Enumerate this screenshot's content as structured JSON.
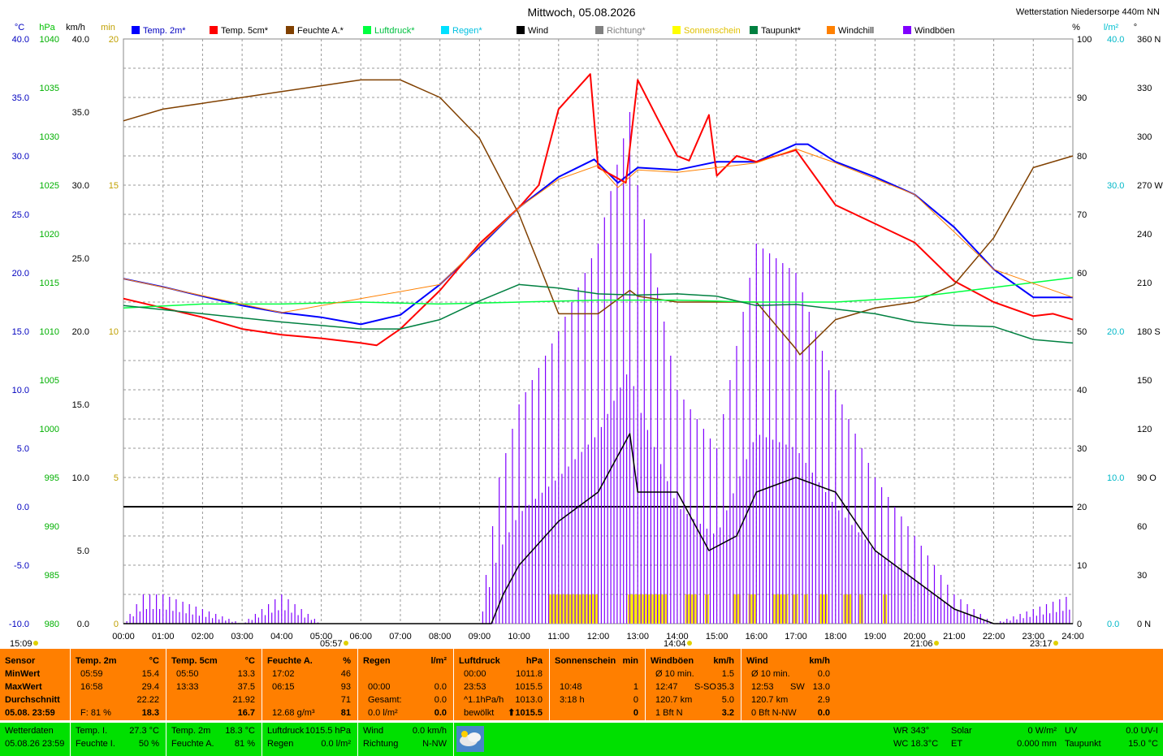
{
  "title": "Mittwoch, 05.08.2026",
  "station": "Wetterstation Niedersorpe 440m NN",
  "axes": {
    "temp_unit": "°C",
    "press_unit": "hPa",
    "wind_unit": "km/h",
    "sun_unit": "min",
    "hum_unit": "%",
    "rain_unit": "l/m²",
    "dir_unit": "°",
    "temp_ticks": [
      "40.0",
      "35.0",
      "30.0",
      "25.0",
      "20.0",
      "15.0",
      "10.0",
      "5.0",
      "0.0",
      "-5.0",
      "-10.0"
    ],
    "press_ticks": [
      "1040",
      "1035",
      "1030",
      "1025",
      "1020",
      "1015",
      "1010",
      "1005",
      "1000",
      "995",
      "990",
      "985",
      "980"
    ],
    "wind_ticks": [
      "40.0",
      "35.0",
      "30.0",
      "25.0",
      "20.0",
      "15.0",
      "10.0",
      "5.0",
      "0.0"
    ],
    "sun_ticks": [
      "20",
      "15",
      "10",
      "5",
      "0"
    ],
    "hum_ticks": [
      "100",
      "90",
      "80",
      "70",
      "60",
      "50",
      "40",
      "30",
      "20",
      "10",
      "0"
    ],
    "rain_ticks": [
      "40.0",
      "30.0",
      "20.0",
      "10.0",
      "0.0"
    ],
    "dir_ticks": [
      "360 N",
      "330",
      "300",
      "270 W",
      "240",
      "210",
      "180 S",
      "150",
      "120",
      "90 O",
      "60",
      "30",
      "0 N"
    ],
    "time_ticks": [
      "00:00",
      "01:00",
      "02:00",
      "03:00",
      "04:00",
      "05:00",
      "06:00",
      "07:00",
      "08:00",
      "09:00",
      "10:00",
      "11:00",
      "12:00",
      "13:00",
      "14:00",
      "15:00",
      "16:00",
      "17:00",
      "18:00",
      "19:00",
      "20:00",
      "21:00",
      "22:00",
      "23:00",
      "24:00"
    ],
    "markers": [
      "15:09",
      "05:57",
      "14:04",
      "21:06",
      "23:17"
    ]
  },
  "legend": [
    {
      "label": "Temp. 2m*",
      "color": "#0000ff"
    },
    {
      "label": "Temp. 5cm*",
      "color": "#ff0000"
    },
    {
      "label": "Feuchte A.*",
      "color": "#804000"
    },
    {
      "label": "Luftdruck*",
      "color": "#00ff40"
    },
    {
      "label": "Regen*",
      "color": "#00e0ff"
    },
    {
      "label": "Wind",
      "color": "#000000"
    },
    {
      "label": "Richtung*",
      "color": "#808080"
    },
    {
      "label": "Sonnenschein",
      "color": "#ffff00"
    },
    {
      "label": "Taupunkt*",
      "color": "#008040"
    },
    {
      "label": "Windchill",
      "color": "#ff8000"
    },
    {
      "label": "Windböen",
      "color": "#8000ff"
    }
  ],
  "chart_data": {
    "type": "line",
    "title": "Mittwoch, 05.08.2026",
    "x_range": [
      0,
      24
    ],
    "temp_range": [
      -10,
      40
    ],
    "humidity_range": [
      0,
      100
    ],
    "pressure_range": [
      980,
      1040
    ],
    "wind_range": [
      0,
      40
    ],
    "series": [
      {
        "name": "Temp. 2m*",
        "axis": "temp",
        "color": "#0000ff",
        "x": [
          0,
          1,
          2,
          3,
          4,
          5,
          6,
          7,
          8,
          9,
          10,
          11,
          11.9,
          12.5,
          13,
          14,
          15,
          16,
          17,
          17.3,
          18,
          19,
          20,
          21,
          22,
          23,
          23.5,
          24
        ],
        "y": [
          19.5,
          18.8,
          18.0,
          17.2,
          16.6,
          16.2,
          15.6,
          16.4,
          19.0,
          22.2,
          25.6,
          28.2,
          29.7,
          27.7,
          29.0,
          28.8,
          29.5,
          29.5,
          31.0,
          31.0,
          29.5,
          28.2,
          26.7,
          23.9,
          20.3,
          17.9,
          17.9,
          17.9
        ]
      },
      {
        "name": "Temp. 5cm*",
        "axis": "temp",
        "color": "#ff0000",
        "x": [
          0,
          1,
          2,
          3,
          4,
          5,
          6,
          6.4,
          7,
          8,
          9,
          10,
          10.5,
          11,
          11.8,
          12,
          12.7,
          13,
          13.5,
          14,
          14.3,
          14.8,
          15,
          15.5,
          16,
          17,
          18,
          19,
          20,
          21,
          22,
          23,
          23.5,
          24
        ],
        "y": [
          17.8,
          17.0,
          16.2,
          15.2,
          14.7,
          14.4,
          14.0,
          13.8,
          15.2,
          18.5,
          22.5,
          25.6,
          27.5,
          34.0,
          37.0,
          29.0,
          27.7,
          36.5,
          33.2,
          30.0,
          29.6,
          33.5,
          28.3,
          30.0,
          29.5,
          30.5,
          25.8,
          24.2,
          22.6,
          19.3,
          17.5,
          16.3,
          16.5,
          16.0
        ]
      },
      {
        "name": "Feuchte A.*",
        "axis": "humidity",
        "color": "#804000",
        "x": [
          0,
          1,
          2,
          3,
          4,
          5,
          6,
          7,
          8,
          9,
          10,
          11,
          12,
          12.8,
          13,
          14,
          15,
          16,
          17,
          17.1,
          18,
          19,
          20,
          21,
          22,
          23,
          24
        ],
        "y": [
          86,
          88,
          89,
          90,
          91,
          92,
          93,
          93,
          90,
          83,
          70,
          53,
          53,
          57,
          56,
          55,
          55,
          55,
          47,
          46,
          52,
          54,
          55,
          58,
          66,
          78,
          80
        ]
      },
      {
        "name": "Luftdruck*",
        "axis": "pressure",
        "color": "#00ff40",
        "x": [
          0,
          2,
          4,
          6,
          8,
          10,
          12,
          14,
          16,
          18,
          20,
          22,
          24
        ],
        "y": [
          1012.4,
          1012.8,
          1012.8,
          1013.0,
          1012.8,
          1013.0,
          1013.2,
          1013.2,
          1013.0,
          1013.0,
          1013.5,
          1014.5,
          1015.5
        ]
      },
      {
        "name": "Taupunkt*",
        "axis": "temp",
        "color": "#008040",
        "x": [
          0,
          2,
          4,
          6,
          7,
          8,
          9,
          10,
          11,
          12,
          13,
          14,
          15,
          16,
          17,
          18,
          19,
          20,
          21,
          22,
          23,
          24
        ],
        "y": [
          17.2,
          16.5,
          15.8,
          15.2,
          15.2,
          16.0,
          17.6,
          19.0,
          18.7,
          18.2,
          18.1,
          18.2,
          18.0,
          17.2,
          17.3,
          16.9,
          16.5,
          15.8,
          15.5,
          15.4,
          14.3,
          14.0
        ]
      },
      {
        "name": "Wind",
        "axis": "wind",
        "color": "#000000",
        "x": [
          0,
          9.3,
          9.6,
          10,
          11,
          12,
          12.8,
          13,
          14,
          14.8,
          15.5,
          16,
          17,
          18,
          19,
          20,
          21,
          22,
          23,
          24
        ],
        "y": [
          0,
          0,
          2,
          4,
          7,
          9,
          13,
          9,
          9,
          5,
          6,
          9,
          10,
          9,
          5,
          3,
          1,
          0,
          0,
          0
        ]
      },
      {
        "name": "Windböen",
        "axis": "wind",
        "color": "#8000ff",
        "x": [
          0,
          0.5,
          1,
          2,
          3,
          4,
          5,
          6,
          7,
          8,
          9,
          9.5,
          10,
          11,
          12,
          12.8,
          13,
          14,
          15,
          16,
          17,
          18,
          19,
          20,
          21,
          22,
          23,
          24
        ],
        "y": [
          0,
          2,
          2,
          1,
          0,
          2,
          0,
          0,
          0,
          0,
          0,
          10,
          15,
          20,
          26,
          35,
          30,
          16,
          12,
          26,
          24,
          16,
          10,
          6,
          2,
          0,
          1,
          2
        ]
      },
      {
        "name": "Windchill",
        "axis": "temp",
        "color": "#ff8000",
        "x": [
          0,
          4,
          8,
          10,
          11,
          12,
          12.5,
          13,
          14,
          16,
          17,
          18,
          20,
          22,
          24
        ],
        "y": [
          19.5,
          16.6,
          19.0,
          25.6,
          28.0,
          29.2,
          27.3,
          28.8,
          28.6,
          29.4,
          30.6,
          29.4,
          26.7,
          20.3,
          17.9
        ]
      }
    ],
    "sunshine_blocks_hours": [
      [
        10.75,
        12.0
      ],
      [
        12.75,
        13.75
      ],
      [
        14.2,
        14.5
      ],
      [
        14.7,
        14.8
      ],
      [
        15.4,
        15.6
      ],
      [
        15.8,
        16.0
      ],
      [
        16.4,
        16.8
      ],
      [
        16.9,
        17.05
      ],
      [
        17.2,
        17.3
      ],
      [
        17.6,
        17.8
      ],
      [
        18.2,
        18.4
      ],
      [
        18.6,
        18.7
      ],
      [
        19.2,
        19.3
      ]
    ],
    "wind_direction_note": "Richtung* dotted series, 0-360°"
  },
  "panel": {
    "c1": {
      "h1": "Sensor",
      "r1": "MinWert",
      "r2": "MaxWert",
      "r3": "Durchschnitt",
      "r4": "05.08. 23:59"
    },
    "c2": {
      "h1": "Temp. 2m",
      "h2": "°C",
      "r1a": "05:59",
      "r1b": "15.4",
      "r2a": "16:58",
      "r2b": "29.4",
      "r3b": "22.22",
      "r4a": "F: 81 %",
      "r4b": "18.3"
    },
    "c3": {
      "h1": "Temp. 5cm",
      "h2": "°C",
      "r1a": "05:50",
      "r1b": "13.3",
      "r2a": "13:33",
      "r2b": "37.5",
      "r3b": "21.92",
      "r4b": "16.7"
    },
    "c4": {
      "h1": "Feuchte A.",
      "h2": "%",
      "r1a": "17:02",
      "r1b": "46",
      "r2a": "06:15",
      "r2b": "93",
      "r3b": "71",
      "r4a": "12.68 g/m³",
      "r4b": "81"
    },
    "c5": {
      "h1": "Regen",
      "h2": "l/m²",
      "r2a": "00:00",
      "r2b": "0.0",
      "r3a": "Gesamt:",
      "r3b": "0.0",
      "r4a": "0.0 l/m²",
      "r4b": "0.0"
    },
    "c6": {
      "h1": "Luftdruck",
      "h2": "hPa",
      "r1a": "00:00",
      "r1b": "1011.8",
      "r2a": "23:53",
      "r2b": "1015.5",
      "r3a": "^1.1hPa/h",
      "r3b": "1013.0",
      "r4a": "bewölkt",
      "r4b": "⬆1015.5"
    },
    "c7": {
      "h1": "Sonnenschein",
      "h2": "min",
      "r2a": "10:48",
      "r2b": "1",
      "r3a": "3:18 h",
      "r3b": "0",
      "r4b": "0"
    },
    "c8": {
      "h1": "Windböen",
      "h2": "km/h",
      "r1a": "Ø 10 min.",
      "r1b": "1.5",
      "r2a": "12:47",
      "r2m": "S-SO",
      "r2b": "35.3",
      "r3a": "120.7 km",
      "r3b": "5.0",
      "r4a": "1 Bft N",
      "r4b": "3.2"
    },
    "c9": {
      "h1": "Wind",
      "h2": "km/h",
      "r1a": "Ø 10 min.",
      "r1b": "0.0",
      "r2a": "12:53",
      "r2m": "SW",
      "r2b": "13.0",
      "r3a": "120.7 km",
      "r3b": "2.9",
      "r4a": "0 Bft N-NW",
      "r4b": "0.0"
    }
  },
  "status": {
    "s1a": "Wetterdaten",
    "s1b": "05.08.26 23:59",
    "s2a": "Temp. I.",
    "s2b": "27.3 °C",
    "s2c": "Feuchte I.",
    "s2d": "50 %",
    "s3a": "Temp. 2m",
    "s3b": "18.3 °C",
    "s3c": "Feuchte A.",
    "s3d": "81 %",
    "s4a": "Luftdruck",
    "s4b": "1015.5 hPa",
    "s4c": "Regen",
    "s4d": "0.0 l/m²",
    "s5a": "Wind",
    "s5b": "0.0 km/h",
    "s5c": "Richtung",
    "s5d": "N-NW",
    "s6a": "WR 343°",
    "s6b": "WC 18.3°C",
    "s7a": "Solar",
    "s7b": "0 W/m²",
    "s7c": "ET",
    "s7d": "0.000 mm",
    "s8a": "UV",
    "s8b": "0.0 UV-I",
    "s8c": "Taupunkt",
    "s8d": "15.0 °C"
  }
}
